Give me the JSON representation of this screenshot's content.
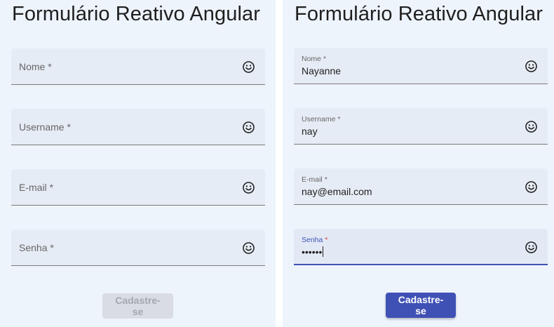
{
  "left_form": {
    "title": "Formulário Reativo Angular",
    "fields": [
      {
        "placeholder": "Nome",
        "required_mark": "*",
        "icon": "smiley-icon"
      },
      {
        "placeholder": "Username",
        "required_mark": "*",
        "icon": "smiley-icon"
      },
      {
        "placeholder": "E-mail",
        "required_mark": "*",
        "icon": "smiley-icon"
      },
      {
        "placeholder": "Senha",
        "required_mark": "*",
        "icon": "smiley-icon"
      }
    ],
    "submit_label": "Cadastre-se",
    "submit_state": "disabled"
  },
  "right_form": {
    "title": "Formulário Reativo Angular",
    "fields": [
      {
        "label": "Nome",
        "required_mark": "*",
        "value": "Nayanne",
        "icon": "smiley-icon"
      },
      {
        "label": "Username",
        "required_mark": "*",
        "value": "nay",
        "icon": "smiley-icon"
      },
      {
        "label": "E-mail",
        "required_mark": "*",
        "value": "nay@email.com",
        "icon": "smiley-icon"
      },
      {
        "label": "Senha",
        "required_mark": "*",
        "value": "••••••",
        "icon": "smiley-icon",
        "focused": true
      }
    ],
    "submit_label": "Cadastre-se",
    "submit_state": "enabled"
  },
  "colors": {
    "panel_bg": "#eef4fc",
    "field_bg": "#e6ecf5",
    "primary": "#3f51b5",
    "required_focused": "#e53935",
    "disabled_bg": "#d9dde3"
  }
}
